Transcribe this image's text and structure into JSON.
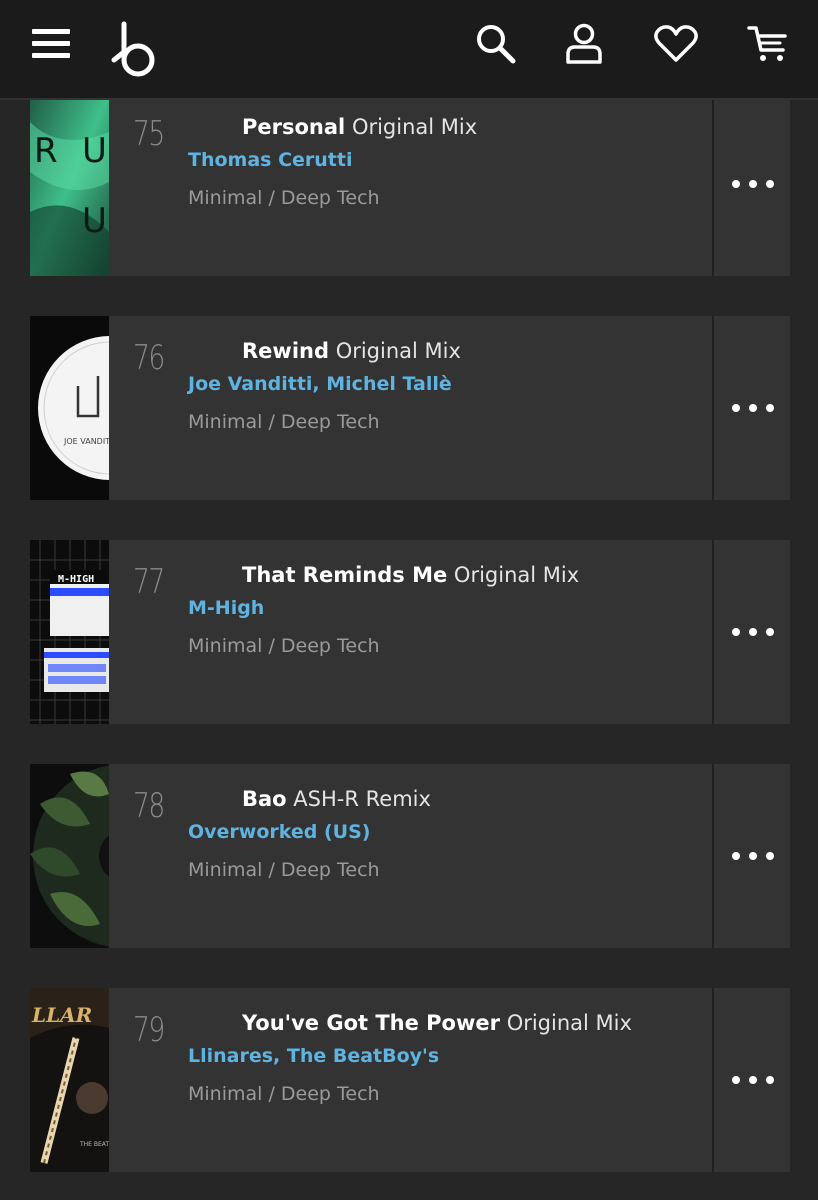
{
  "header": {
    "menu_icon": "hamburger-menu-icon",
    "logo_icon": "beatport-logo-icon",
    "search_icon": "search-icon",
    "account_icon": "user-icon",
    "wishlist_icon": "heart-icon",
    "cart_icon": "cart-icon"
  },
  "tracks": [
    {
      "number": "75",
      "title": "Personal",
      "mix": "Original Mix",
      "artist": "Thomas Cerutti",
      "genre": "Minimal / Deep Tech"
    },
    {
      "number": "76",
      "title": "Rewind",
      "mix": "Original Mix",
      "artist": "Joe Vanditti, Michel Tallè",
      "genre": "Minimal / Deep Tech"
    },
    {
      "number": "77",
      "title": "That Reminds Me",
      "mix": "Original Mix",
      "artist": "M-High",
      "genre": "Minimal / Deep Tech"
    },
    {
      "number": "78",
      "title": "Bao",
      "mix": "ASH-R Remix",
      "artist": "Overworked (US)",
      "genre": "Minimal / Deep Tech"
    },
    {
      "number": "79",
      "title": "You've Got The Power",
      "mix": "Original Mix",
      "artist": "Llinares, The BeatBoy's",
      "genre": "Minimal / Deep Tech"
    }
  ],
  "colors": {
    "accent": "#5fb3e0",
    "row_bg": "#333333",
    "page_bg": "#262626",
    "header_bg": "#1b1b1b"
  }
}
